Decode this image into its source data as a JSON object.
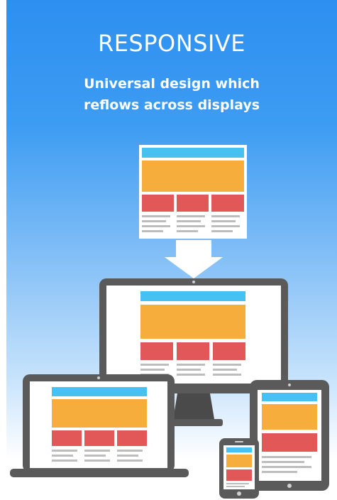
{
  "header": {
    "title": "RESPONSIVE",
    "subtitle_line1": "Universal design which",
    "subtitle_line2": "reflows across displays"
  },
  "colors": {
    "header_bar": "#46c2f2",
    "hero_block": "#f7ad3c",
    "card_block": "#e25757",
    "text_line": "#bdbdbd",
    "device_frame": "#5a5a5a",
    "arrow": "#ffffff"
  },
  "icons": [
    "wireframe-page-icon",
    "down-arrow-icon",
    "desktop-monitor-icon",
    "laptop-icon",
    "tablet-icon",
    "smartphone-icon"
  ]
}
